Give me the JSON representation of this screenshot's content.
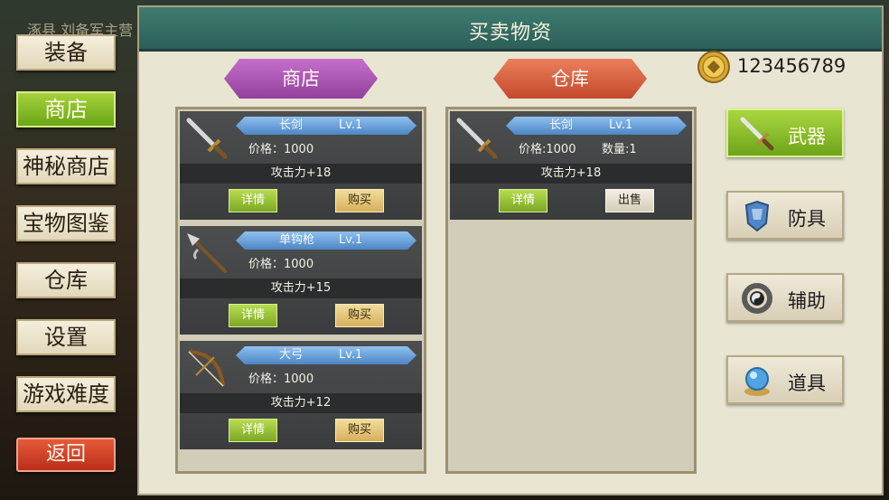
{
  "background": {
    "caption": "涿县 刘备军主营"
  },
  "sidebar": {
    "items": [
      {
        "label": "装备"
      },
      {
        "label": "商店"
      },
      {
        "label": "神秘商店"
      },
      {
        "label": "宝物图鉴"
      },
      {
        "label": "仓库"
      },
      {
        "label": "设置"
      },
      {
        "label": "游戏难度"
      }
    ],
    "active_index": 1,
    "back_label": "返回"
  },
  "panel": {
    "title": "买卖物资",
    "money": "123456789",
    "shop_tab": "商店",
    "store_tab": "仓库"
  },
  "shop": {
    "items": [
      {
        "name": "长剑",
        "level": "Lv.1",
        "price": "价格：1000",
        "stat": "攻击力+18",
        "detail": "详情",
        "buy": "购买",
        "icon": "sword-icon"
      },
      {
        "name": "单钩枪",
        "level": "Lv.1",
        "price": "价格：1000",
        "stat": "攻击力+15",
        "detail": "详情",
        "buy": "购买",
        "icon": "spear-icon"
      },
      {
        "name": "大弓",
        "level": "Lv.1",
        "price": "价格：1000",
        "stat": "攻击力+12",
        "detail": "详情",
        "buy": "购买",
        "icon": "bow-icon"
      }
    ]
  },
  "storage": {
    "items": [
      {
        "name": "长剑",
        "level": "Lv.1",
        "price": "价格:1000",
        "quantity": "数量:1",
        "stat": "攻击力+18",
        "detail": "详情",
        "sell": "出售",
        "icon": "sword-icon"
      }
    ]
  },
  "categories": {
    "items": [
      {
        "label": "武器",
        "icon": "weapon-icon"
      },
      {
        "label": "防具",
        "icon": "armor-icon"
      },
      {
        "label": "辅助",
        "icon": "accessory-icon"
      },
      {
        "label": "道具",
        "icon": "item-orb-icon"
      }
    ],
    "active_index": 0
  }
}
